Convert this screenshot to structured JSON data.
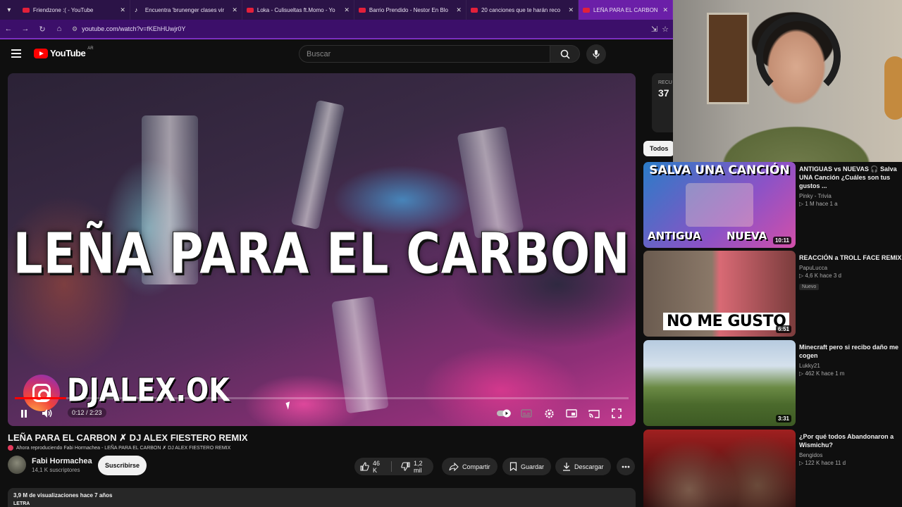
{
  "browser": {
    "tabs": [
      {
        "title": "Friendzone :( - YouTube",
        "icon": "youtube-favicon",
        "active": false
      },
      {
        "title": "Encuentra 'brunenger clases vir",
        "icon": "tiktok-favicon",
        "active": false
      },
      {
        "title": "Loka - Culisueltas ft.Momo - Yo",
        "icon": "youtube-favicon",
        "active": false
      },
      {
        "title": "Barrio Prendido - Nestor En Blo",
        "icon": "youtube-favicon",
        "active": false
      },
      {
        "title": "20 canciones que te harán reco",
        "icon": "youtube-favicon",
        "active": false
      },
      {
        "title": "LEÑA PARA EL CARBON ✗",
        "icon": "youtube-favicon",
        "active": true
      }
    ],
    "url": "youtube.com/watch?v=fKEhHUwjr0Y"
  },
  "header": {
    "logo_text": "YouTube",
    "country_code": "AR",
    "search_placeholder": "Buscar"
  },
  "player": {
    "overlay_title": "LEÑA PARA EL CARBON",
    "overlay_handle": "DJALEX.OK",
    "time": "0:12 / 2:23",
    "progress": 0.084
  },
  "video": {
    "title": "LEÑA PARA EL CARBON ✗ DJ ALEX FIESTERO REMIX",
    "now_playing": "Ahora reproduciendo Fabi Hormachea - LEÑA PARA EL CARBON ✗ DJ ALEX FIESTERO REMIX",
    "channel_name": "Fabi Hormachea",
    "subscribers": "14,1 K suscriptores",
    "subscribe_label": "Suscribirse",
    "likes": "46 K",
    "dislikes": "1,2 mil",
    "share_label": "Compartir",
    "save_label": "Guardar",
    "download_label": "Descargar",
    "views_and_age": "3,9 M de visualizaciones  hace 7 años",
    "description_start": "LETRA"
  },
  "sidebar": {
    "live_label": "RECU",
    "live_number": "37",
    "chip_all": "Todos",
    "recommendations": [
      {
        "title": "ANTIGUAS vs NUEVAS 🎧 Salva UNA Canción ¿Cuáles son tus gustos ...",
        "channel": "Pinky - Trivia",
        "stats": "▷ 1 M  hace 1 a",
        "duration": "10:11",
        "thumb_top": "SALVA UNA CANCIÓN",
        "thumb_left": "ANTIGUA",
        "thumb_right": "NUEVA",
        "new": ""
      },
      {
        "title": "REACCIÓN a TROLL FACE REMIX",
        "channel": "PapuLucca",
        "stats": "▷ 4,6 K  hace 3 d",
        "duration": "6:51",
        "thumb_caption": "NO ME GUSTO",
        "new": "Nuevo"
      },
      {
        "title": "Minecraft pero si recibo daño me cogen",
        "channel": "Lukky21",
        "stats": "▷ 462 K  hace 1 m",
        "duration": "3:31",
        "new": ""
      },
      {
        "title": "¿Por qué todos Abandonaron a Wismichu?",
        "channel": "Bengidos",
        "stats": "▷ 122 K  hace 11 d",
        "duration": "",
        "new": ""
      }
    ]
  },
  "colors": {
    "brand_red": "#ff0000",
    "background": "#0f0f0f",
    "browser_accent": "#6b1fa8"
  }
}
